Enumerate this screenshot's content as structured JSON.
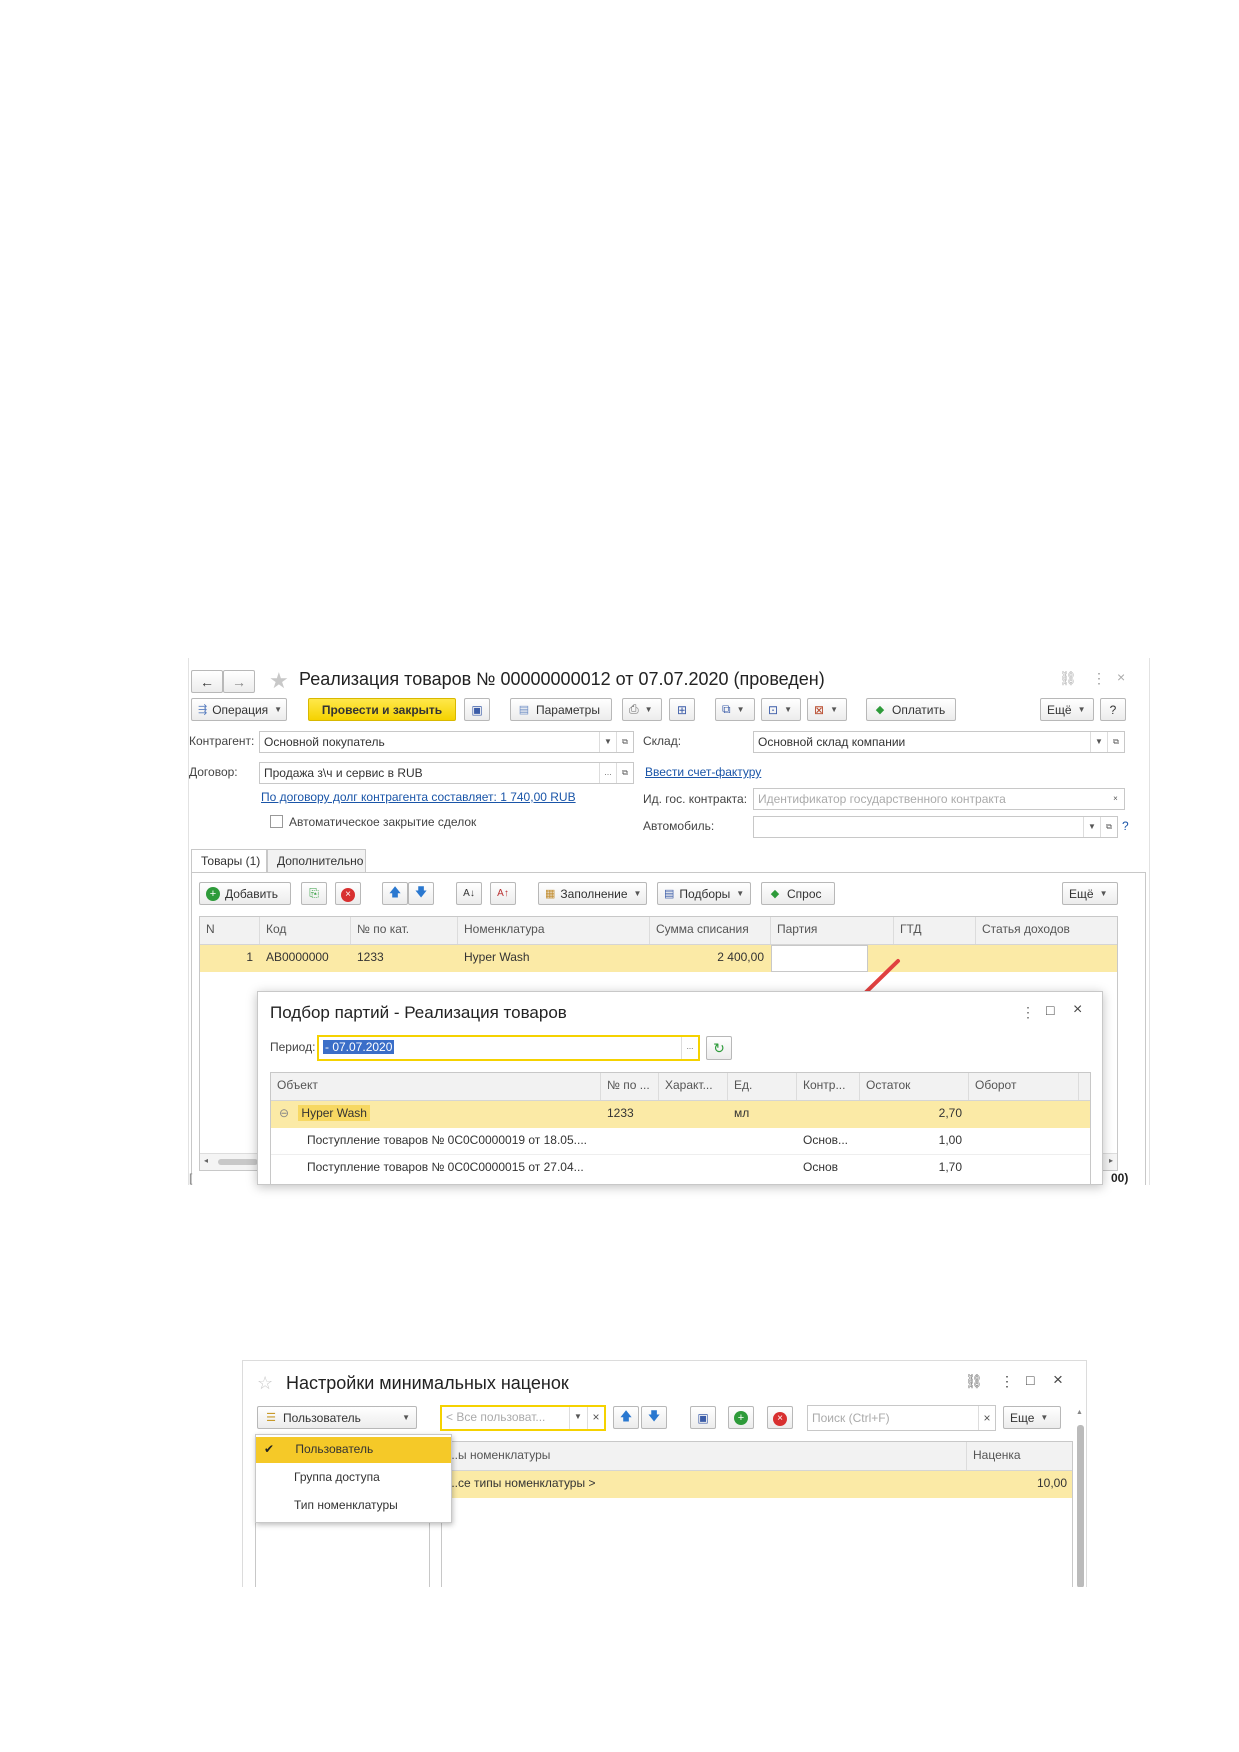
{
  "win1": {
    "title": "Реализация товаров № 00000000012 от 07.07.2020 (проведен)",
    "toolbar": {
      "operation": "Операция",
      "post_close": "Провести и закрыть",
      "params": "Параметры",
      "pay": "Оплатить",
      "more": "Ещё",
      "help": "?"
    },
    "form": {
      "counterparty_label": "Контрагент:",
      "counterparty_value": "Основной покупатель",
      "warehouse_label": "Склад:",
      "warehouse_value": "Основной склад компании",
      "contract_label": "Договор:",
      "contract_value": "Продажа з\\ч и сервис в RUB",
      "invoice_link": "Ввести счет-фактуру",
      "debt_link": "По договору долг контрагента составляет: 1 740,00 RUB",
      "gov_label": "Ид. гос. контракта:",
      "gov_placeholder": "Идентификатор государственного контракта",
      "auto_close_label": "Автоматическое закрытие сделок",
      "car_label": "Автомобиль:",
      "car_help": "?"
    },
    "tabs": [
      "Товары (1)",
      "Дополнительно"
    ],
    "table_toolbar": {
      "add": "Добавить",
      "fill": "Заполнение",
      "picks": "Подборы",
      "request": "Спрос",
      "more": "Ещё"
    },
    "columns": [
      "N",
      "Код",
      "№ по кат.",
      "Номенклатура",
      "Сумма списания",
      "Партия",
      "ГТД",
      "Статья доходов"
    ],
    "rows": [
      {
        "n": "1",
        "code": "АВ0000000",
        "cat": "1233",
        "name": "Hyper Wash",
        "sum": "2 400,00",
        "batch": "",
        "gtd": "",
        "income": ""
      }
    ],
    "bottom_left": "[",
    "bottom_right": "00)"
  },
  "dialog": {
    "title": "Подбор партий - Реализация товаров",
    "period_label": "Период:",
    "period_value": "- 07.07.2020",
    "period_btn": "...",
    "columns": [
      "Объект",
      "№ по ...",
      "Характ...",
      "Ед.",
      "Контр...",
      "Остаток",
      "Оборот"
    ],
    "group_row": {
      "name": "Hyper Wash",
      "cat": "1233",
      "unit": "мл",
      "rest": "2,70",
      "expand": "⊖"
    },
    "rows": [
      {
        "name": "Поступление товаров № 0С0С0000019 от 18.05....",
        "contr": "Основ...",
        "rest": "1,00"
      },
      {
        "name": "Поступление товаров № 0С0С0000015 от 27.04...",
        "contr": "Основ",
        "rest": "1,70"
      }
    ]
  },
  "win2": {
    "title": "Настройки минимальных наценок",
    "selector_value": "Пользователь",
    "filter_placeholder": "< Все пользоват...",
    "search_placeholder": "Поиск (Ctrl+F)",
    "more": "Еще",
    "clear": "×",
    "menu": [
      "Пользователь",
      "Группа доступа",
      "Тип номенклатуры"
    ],
    "columns": [
      "...ы номенклатуры",
      "Наценка"
    ],
    "rows": [
      {
        "name": "...се типы номенклатуры >",
        "markup": "10,00"
      }
    ]
  },
  "colors": {
    "accent_yellow": "#f5d200",
    "selected_row": "#fbeaa6",
    "link_blue": "#1a55a8",
    "arrow_red": "#e04040"
  }
}
